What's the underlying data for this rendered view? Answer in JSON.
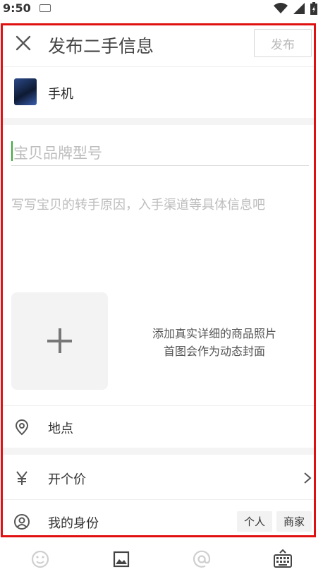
{
  "status_bar": {
    "time": "9:50",
    "icons": [
      "keyboard-indicator-icon",
      "wifi-icon",
      "signal-icon",
      "battery-icon"
    ]
  },
  "header": {
    "title": "发布二手信息",
    "publish_label": "发布",
    "close_icon": "close-icon"
  },
  "category": {
    "label": "手机"
  },
  "form": {
    "model_placeholder": "宝贝品牌型号",
    "description_placeholder": "写写宝贝的转手原因，入手渠道等具体信息吧",
    "photo_hint_line1": "添加真实详细的商品照片",
    "photo_hint_line2": "首图会作为动态封面"
  },
  "rows": {
    "location_label": "地点",
    "price_label": "开个价",
    "identity_label": "我的身份",
    "identity_options": [
      "个人",
      "商家"
    ]
  },
  "toolbar": {
    "icons": [
      "emoji-icon",
      "image-icon",
      "mention-icon",
      "keyboard-icon"
    ]
  },
  "colors": {
    "accent_cursor": "#39a838",
    "frame_border": "#e01010",
    "placeholder": "#bdbdbd",
    "icon_gray": "#cfcfcf"
  }
}
